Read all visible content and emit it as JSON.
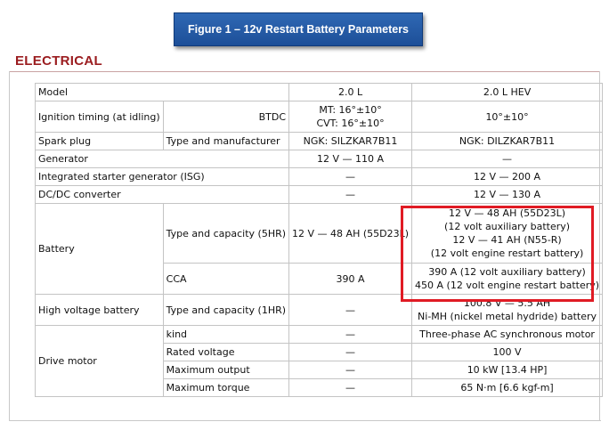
{
  "figure_title": "Figure 1 – 12v Restart Battery Parameters",
  "section_title": "ELECTRICAL",
  "columns": {
    "v20": "2.0 L",
    "hev": "2.0 L HEV"
  },
  "rows": {
    "model": {
      "label": "Model"
    },
    "ignition": {
      "label": "Ignition timing (at idling)",
      "sub": "BTDC",
      "v20_line1": "MT: 16°±10°",
      "v20_line2": "CVT: 16°±10°",
      "hev": "10°±10°"
    },
    "spark": {
      "label": "Spark plug",
      "sub": "Type and manufacturer",
      "v20": "NGK: SILZKAR7B11",
      "hev": "NGK: DILZKAR7B11"
    },
    "generator": {
      "label": "Generator",
      "v20": "12 V — 110 A",
      "hev": "—"
    },
    "isg": {
      "label": "Integrated starter generator (ISG)",
      "v20": "—",
      "hev": "12 V — 200 A"
    },
    "dcdc": {
      "label": "DC/DC converter",
      "v20": "—",
      "hev": "12 V — 130 A"
    },
    "battery": {
      "label": "Battery",
      "capacity": {
        "sub": "Type and capacity (5HR)",
        "v20": "12 V — 48 AH (55D23L)",
        "hev_line1": "12 V — 48 AH (55D23L)",
        "hev_line2": "(12 volt auxiliary battery)",
        "hev_line3": "12 V — 41 AH (N55-R)",
        "hev_line4": "(12 volt engine restart battery)"
      },
      "cca": {
        "sub": "CCA",
        "v20": "390 A",
        "hev_line1": "390 A (12 volt auxiliary battery)",
        "hev_line2": "450 A (12 volt engine restart battery)"
      }
    },
    "hv_battery": {
      "label": "High voltage battery",
      "sub": "Type and capacity (1HR)",
      "v20": "—",
      "hev_line1": "100.8 V — 5.5 AH",
      "hev_line2": "Ni-MH (nickel metal hydride) battery"
    },
    "motor": {
      "label": "Drive motor",
      "kind": {
        "sub": "kind",
        "v20": "—",
        "hev": "Three-phase AC synchronous motor"
      },
      "voltage": {
        "sub": "Rated voltage",
        "v20": "—",
        "hev": "100 V"
      },
      "output": {
        "sub": "Maximum output",
        "v20": "—",
        "hev": "10 kW [13.4 HP]"
      },
      "torque": {
        "sub": "Maximum torque",
        "v20": "—",
        "hev": "65 N·m [6.6 kgf-m]"
      }
    }
  },
  "colors": {
    "banner": "#1d4f98",
    "section_title": "#9b1d20",
    "highlight": "#e01b24",
    "border": "#c4c4c4"
  }
}
